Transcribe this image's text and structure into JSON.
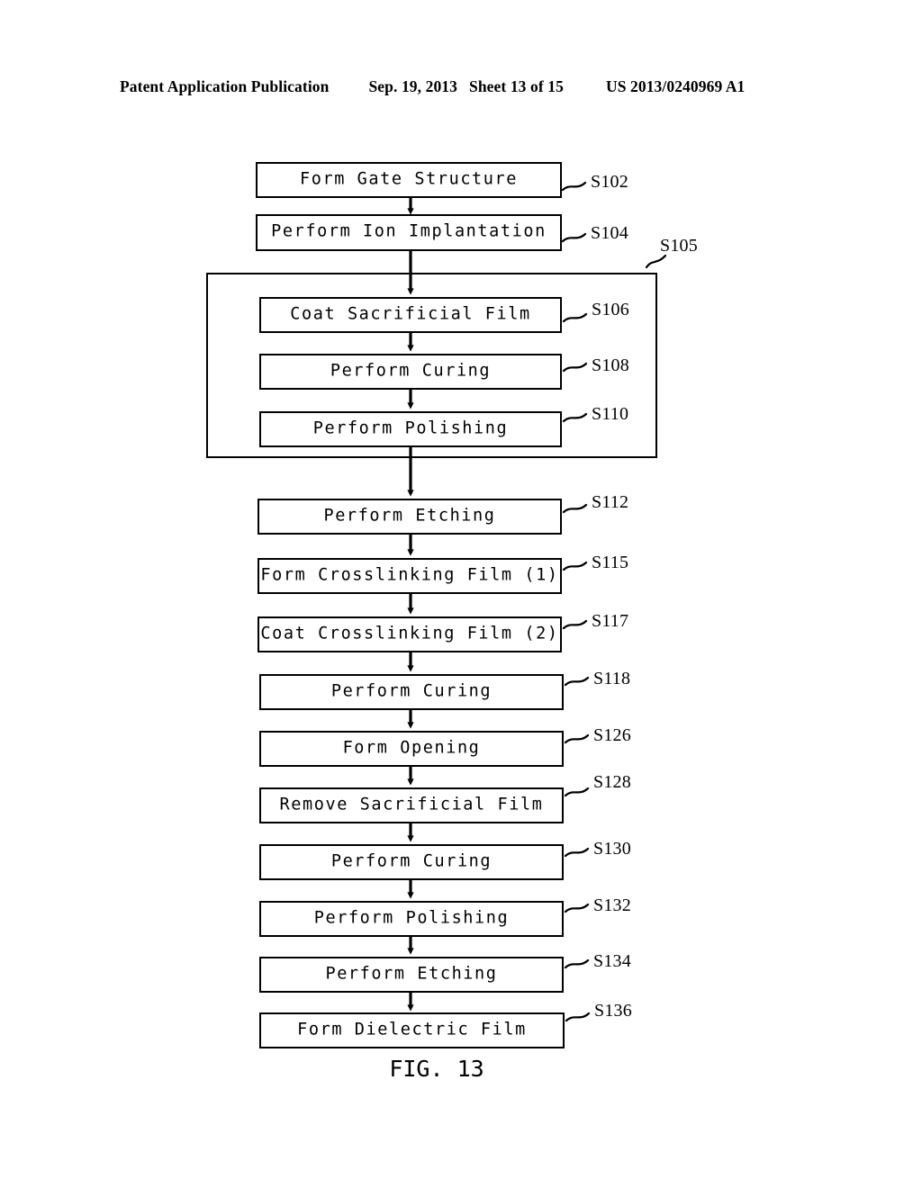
{
  "header": {
    "publication": "Patent Application Publication",
    "date": "Sep. 19, 2013",
    "sheet": "Sheet 13 of 15",
    "patent_number": "US 2013/0240969 A1"
  },
  "figure": {
    "caption": "FIG. 13",
    "type": "process-flowchart"
  },
  "group": {
    "ref": "S105",
    "contains": [
      "S106",
      "S108",
      "S110"
    ]
  },
  "steps": [
    {
      "ref": "S102",
      "label": "Form Gate Structure"
    },
    {
      "ref": "S104",
      "label": "Perform Ion Implantation"
    },
    {
      "ref": "S106",
      "label": "Coat Sacrificial Film"
    },
    {
      "ref": "S108",
      "label": "Perform Curing"
    },
    {
      "ref": "S110",
      "label": "Perform Polishing"
    },
    {
      "ref": "S112",
      "label": "Perform Etching"
    },
    {
      "ref": "S115",
      "label": "Form Crosslinking Film (1)"
    },
    {
      "ref": "S117",
      "label": "Coat Crosslinking Film (2)"
    },
    {
      "ref": "S118",
      "label": "Perform Curing"
    },
    {
      "ref": "S126",
      "label": "Form Opening"
    },
    {
      "ref": "S128",
      "label": "Remove Sacrificial Film"
    },
    {
      "ref": "S130",
      "label": "Perform Curing"
    },
    {
      "ref": "S132",
      "label": "Perform Polishing"
    },
    {
      "ref": "S134",
      "label": "Perform Etching"
    },
    {
      "ref": "S136",
      "label": "Form Dielectric Film"
    }
  ],
  "colors": {
    "ink": "#000000",
    "paper": "#ffffff"
  }
}
